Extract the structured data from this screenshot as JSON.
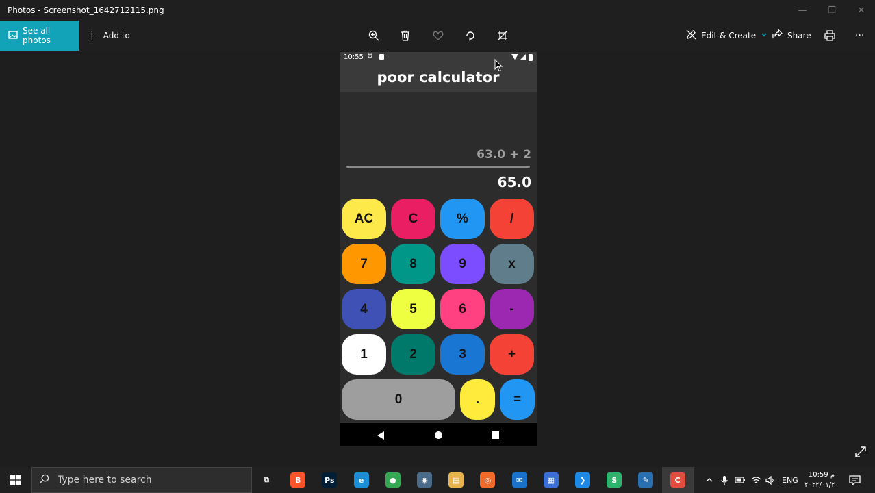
{
  "window": {
    "title": "Photos - Screenshot_1642712115.png",
    "minimize_glyph": "—",
    "restore_glyph": "❐",
    "close_glyph": "✕"
  },
  "toolbar": {
    "see_all_label": "See all photos",
    "add_to_label": "Add to",
    "add_glyph": "+",
    "edit_create_label": "Edit & Create",
    "share_label": "Share",
    "more_glyph": "···",
    "accent": "#12a3b8"
  },
  "phone": {
    "status_time": "10:55",
    "app_title": "poor calculator",
    "expression": "63.0 + 2",
    "result": "65.0",
    "keys": [
      {
        "label": "AC",
        "color": "#fde94a"
      },
      {
        "label": "C",
        "color": "#e91e63"
      },
      {
        "label": "%",
        "color": "#2196f3"
      },
      {
        "label": "/",
        "color": "#f44336"
      },
      {
        "label": "7",
        "color": "#ff9800"
      },
      {
        "label": "8",
        "color": "#009688"
      },
      {
        "label": "9",
        "color": "#7c4dff"
      },
      {
        "label": "x",
        "color": "#607d8b"
      },
      {
        "label": "4",
        "color": "#3f51b5"
      },
      {
        "label": "5",
        "color": "#eeff41"
      },
      {
        "label": "6",
        "color": "#ff4081"
      },
      {
        "label": "-",
        "color": "#9c27b0"
      },
      {
        "label": "1",
        "color": "#ffffff"
      },
      {
        "label": "2",
        "color": "#00796b"
      },
      {
        "label": "3",
        "color": "#1976d2"
      },
      {
        "label": "+",
        "color": "#f44336"
      },
      {
        "label": "0",
        "color": "#9e9e9e"
      },
      {
        "label": ".",
        "color": "#ffeb3b"
      },
      {
        "label": "=",
        "color": "#2196f3"
      }
    ]
  },
  "taskbar": {
    "search_placeholder": "Type here to search",
    "language": "ENG",
    "clock_time": "10:59 م",
    "clock_date": "٢٠٢٢/٠١/٢٠",
    "apps": [
      {
        "name": "task-view",
        "color": "#202020",
        "glyph": "⧉"
      },
      {
        "name": "brave",
        "color": "#fb542b",
        "glyph": "B"
      },
      {
        "name": "photoshop",
        "color": "#001e36",
        "glyph": "Ps"
      },
      {
        "name": "edge",
        "color": "#1b8fd6",
        "glyph": "e"
      },
      {
        "name": "chrome",
        "color": "#34a853",
        "glyph": "●"
      },
      {
        "name": "camera",
        "color": "#4a6a8a",
        "glyph": "◉"
      },
      {
        "name": "file-explorer",
        "color": "#e8b34a",
        "glyph": "▤"
      },
      {
        "name": "media-app",
        "color": "#f06a2a",
        "glyph": "◎"
      },
      {
        "name": "mail",
        "color": "#1a73c8",
        "glyph": "✉"
      },
      {
        "name": "store",
        "color": "#3a6fd8",
        "glyph": "▦"
      },
      {
        "name": "vscode",
        "color": "#1e88e5",
        "glyph": "❯"
      },
      {
        "name": "app-green",
        "color": "#2db36b",
        "glyph": "S"
      },
      {
        "name": "screenshot-tool",
        "color": "#2a6fb0",
        "glyph": "✎"
      },
      {
        "name": "recorder",
        "color": "#e34d3f",
        "glyph": "C"
      }
    ]
  }
}
